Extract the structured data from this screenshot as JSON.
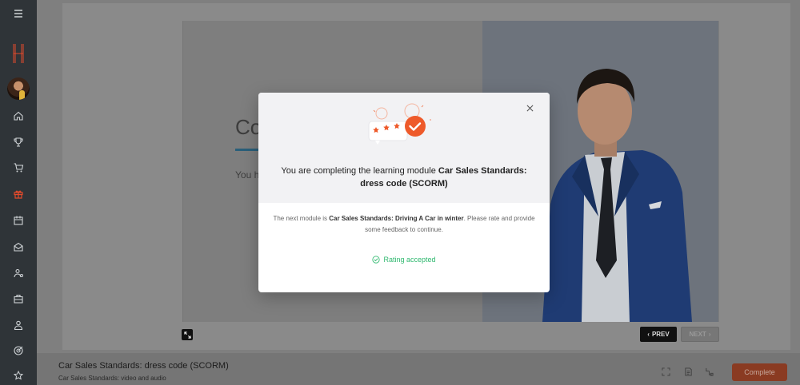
{
  "sidebar": {
    "logo": "H",
    "items": [
      {
        "icon": "menu-icon"
      },
      {
        "icon": "home-icon"
      },
      {
        "icon": "trophy-icon"
      },
      {
        "icon": "cart-icon"
      },
      {
        "icon": "gift-icon"
      },
      {
        "icon": "calendar-icon"
      },
      {
        "icon": "inbox-icon"
      },
      {
        "icon": "users-icon"
      },
      {
        "icon": "briefcase-icon"
      },
      {
        "icon": "user-icon"
      },
      {
        "icon": "target-icon"
      },
      {
        "icon": "star-icon"
      }
    ]
  },
  "slide": {
    "title": "Congr",
    "text": "You have suc",
    "prev_label": "PREV",
    "next_label": "NEXT"
  },
  "bottom": {
    "title": "Car Sales Standards: dress code (SCORM)",
    "subtitle": "Car Sales Standards: video and audio",
    "complete_label": "Complete"
  },
  "modal": {
    "heading_prefix": "You are completing the learning module ",
    "heading_module": "Car Sales Standards: dress code (SCORM)",
    "body_prefix": "The next module is ",
    "body_module": "Car Sales Standards: Driving A Car in winter",
    "body_suffix": ". Please rate and provide some feedback to continue.",
    "rating_status": "Rating accepted"
  },
  "colors": {
    "accent": "#ee5a2a",
    "success": "#2eb86e",
    "sidebar_bg": "#2f3438"
  }
}
